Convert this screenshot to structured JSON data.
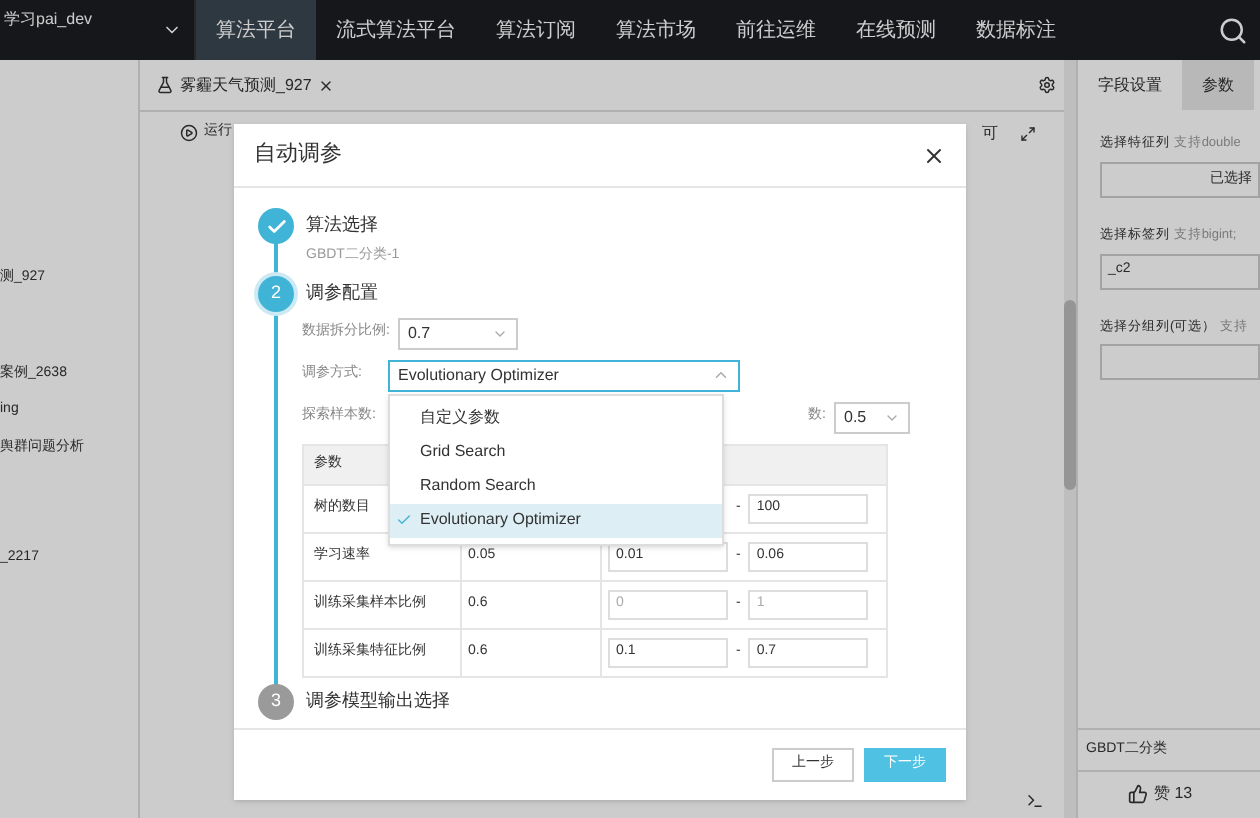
{
  "topbar": {
    "project": "学习pai_dev",
    "tabs": [
      {
        "label": "算法平台",
        "selected": true
      },
      {
        "label": "流式算法平台",
        "selected": false
      },
      {
        "label": "算法订阅",
        "selected": false
      },
      {
        "label": "算法市场",
        "selected": false
      },
      {
        "label": "前往运维",
        "selected": false
      },
      {
        "label": "在线预测",
        "selected": false
      },
      {
        "label": "数据标注",
        "selected": false
      }
    ]
  },
  "sidebar": {
    "items": [
      "测_927",
      "案例_2638",
      "ing",
      "舆群问题分析",
      "_2217"
    ]
  },
  "canvas": {
    "tab": "雾霾天气预测_927",
    "run": "运行",
    "toolbar_text": "可"
  },
  "right_panel": {
    "tabs": [
      {
        "label": "字段设置",
        "selected": true
      },
      {
        "label": "参数",
        "selected": false
      }
    ],
    "fields": [
      {
        "label": "选择特征列",
        "hint": "支持double",
        "value": "已选择"
      },
      {
        "label": "选择标签列",
        "hint": "支持bigint;",
        "value": "_c2"
      },
      {
        "label": "选择分组列(可选）",
        "hint": "支持"
      }
    ],
    "footer": "GBDT二分类",
    "likes": "赞 13"
  },
  "dialog": {
    "title": "自动调参",
    "steps": [
      {
        "title": "算法选择",
        "subtitle": "GBDT二分类-1",
        "completed": true,
        "current": false
      },
      {
        "number": "2",
        "title": "调参配置",
        "completed": false,
        "current": true
      },
      {
        "number": "3",
        "title": "调参模型输出选择",
        "completed": false,
        "current": false
      }
    ],
    "split_label": "数据拆分比例:",
    "split_value": "0.7",
    "method_label": "调参方式:",
    "method_value": "Evolutionary Optimizer",
    "sample_label": "探索样本数:",
    "ratio_label": "数:",
    "ratio_value": "0.5",
    "table": {
      "columns": [
        "参数"
      ],
      "rows": [
        {
          "name": "树的数目",
          "separator": "-",
          "max": "100",
          "disabled": false
        },
        {
          "name": "学习速率",
          "default": "0.05",
          "min": "0.01",
          "separator": "-",
          "max": "0.06",
          "disabled": false
        },
        {
          "name": "训练采集样本比例",
          "default": "0.6",
          "min": "0",
          "separator": "-",
          "max": "1",
          "disabled": true
        },
        {
          "name": "训练采集特征比例",
          "default": "0.6",
          "min": "0.1",
          "separator": "-",
          "max": "0.7",
          "disabled": false
        }
      ]
    },
    "dropdown": [
      {
        "label": "自定义参数",
        "selected": false
      },
      {
        "label": "Grid Search",
        "selected": false
      },
      {
        "label": "Random Search",
        "selected": false
      },
      {
        "label": "Evolutionary Optimizer",
        "selected": true
      }
    ],
    "buttons": {
      "back": "上一步",
      "next": "下一步"
    }
  }
}
